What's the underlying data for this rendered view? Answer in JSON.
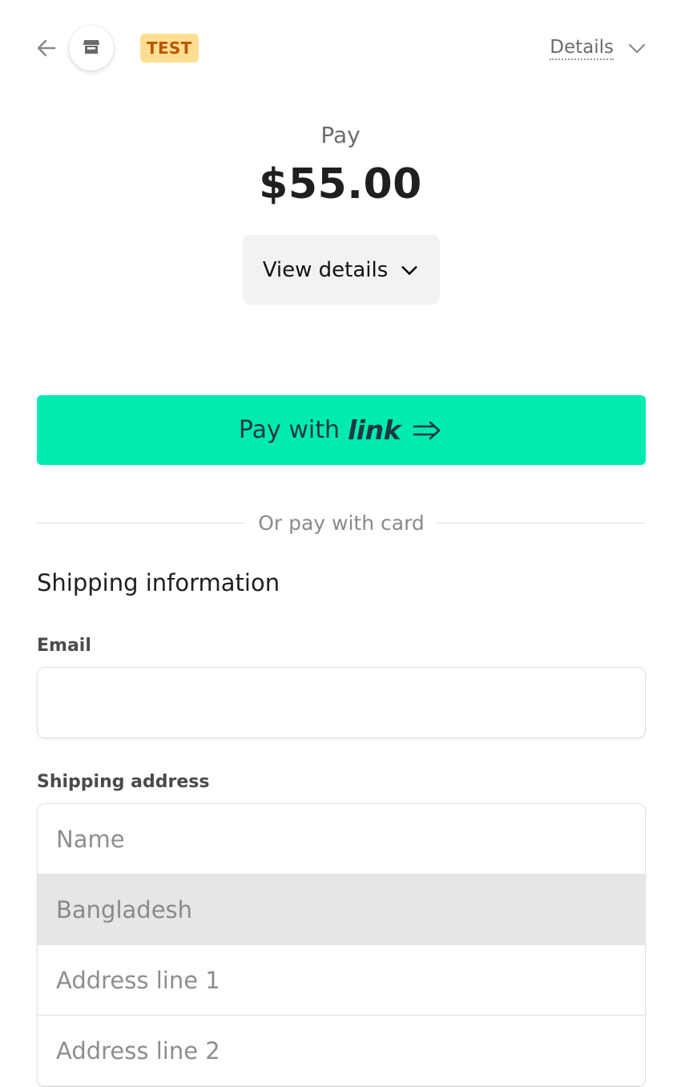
{
  "header": {
    "back_icon": "arrow-left-icon",
    "store_icon": "store-icon",
    "badge": "TEST",
    "details_label": "Details",
    "details_icon": "chevron-down-icon"
  },
  "summary": {
    "pay_label": "Pay",
    "amount": "$55.00",
    "view_details_label": "View details",
    "view_details_icon": "chevron-down-icon"
  },
  "link_button": {
    "prefix": "Pay with",
    "wordmark": "link",
    "arrow_icon": "double-arrow-right-icon",
    "background": "#00ebb0",
    "text_color": "#1d3944"
  },
  "divider": {
    "text": "Or pay with card"
  },
  "shipping": {
    "title": "Shipping information",
    "email": {
      "label": "Email",
      "value": "",
      "placeholder": ""
    },
    "address_label": "Shipping address",
    "name_placeholder": "Name",
    "country": "Bangladesh",
    "address_line1_placeholder": "Address line 1",
    "address_line2_placeholder": "Address line 2"
  },
  "colors": {
    "badge_bg": "#ffde92",
    "badge_text": "#bb5504",
    "country_bg": "#e6e6e6"
  }
}
